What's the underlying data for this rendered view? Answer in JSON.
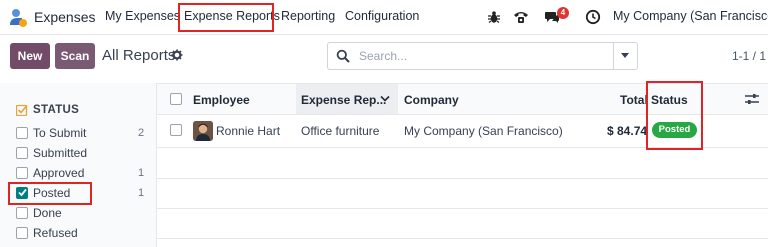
{
  "navbar": {
    "app_name": "Expenses",
    "menus": [
      "My Expenses",
      "Expense Reports",
      "Reporting",
      "Configuration"
    ],
    "message_badge": "4",
    "company": "My Company (San Francisco)"
  },
  "control_panel": {
    "new_label": "New",
    "scan_label": "Scan",
    "breadcrumb": "All Reports",
    "search_placeholder": "Search...",
    "pager": "1-1 / 1"
  },
  "side_panel": {
    "heading": "STATUS",
    "filters": [
      {
        "label": "To Submit",
        "count": "2",
        "checked": false
      },
      {
        "label": "Submitted",
        "count": "",
        "checked": false
      },
      {
        "label": "Approved",
        "count": "1",
        "checked": false
      },
      {
        "label": "Posted",
        "count": "1",
        "checked": true
      },
      {
        "label": "Done",
        "count": "",
        "checked": false
      },
      {
        "label": "Refused",
        "count": "",
        "checked": false
      }
    ]
  },
  "list": {
    "columns": [
      "Employee",
      "Expense Rep...",
      "Company",
      "Total",
      "Status"
    ],
    "rows": [
      {
        "employee": "Ronnie Hart",
        "report": "Office furniture",
        "company": "My Company (San Francisco)",
        "total": "$ 84.74",
        "status": "Posted"
      }
    ]
  },
  "colors": {
    "brand": "#714b67",
    "posted_badge": "#28a745",
    "highlight": "#e02424",
    "checkbox_checked": "#017e84"
  }
}
